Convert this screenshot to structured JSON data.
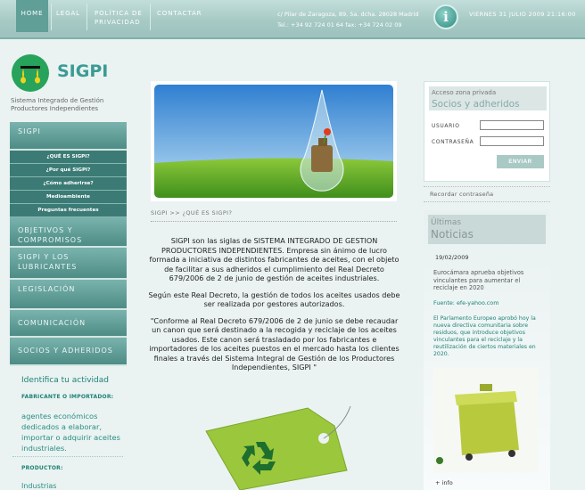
{
  "nav": {
    "home": "HOME",
    "legal": "LEGAL",
    "privacidad_l1": "POLÍTICA DE",
    "privacidad_l2": "PRIVACIDAD",
    "contactar": "CONTACTAR"
  },
  "address": {
    "line1": "c/ Pilar de Zaragoza, 89, 5a. dcha.   28028 Madrid",
    "line2": "Tel.: +34 92 724 01 64   fax: +34 724 02 09"
  },
  "datetime": "VIERNES 31 JULIO 2009    21:16:00",
  "info_icon": "i",
  "logo": {
    "name": "SIGPI",
    "sub_l1": "Sistema Integrado de Gestión",
    "sub_l2": "Productores Independientes"
  },
  "sidebar": {
    "sigpi": "SIGPI",
    "sub_items": [
      "¿QUÉ ES SIGPI?",
      "¿Por qué SIGPI?",
      "¿Cómo adherirse?",
      "Medioambiente",
      "Preguntas frecuentes"
    ],
    "objetivos_l1": "OBJETIVOS Y",
    "objetivos_l2": "COMPROMISOS",
    "lubricantes_l1": "SIGPI Y LOS",
    "lubricantes_l2": "LUBRICANTES",
    "legislacion": "LEGISLACIÓN",
    "comunicacion": "COMUNICACIÓN",
    "socios": "SOCIOS Y ADHERIDOS"
  },
  "identify": {
    "title": "Identifica tu actividad",
    "fabricante": "FABRICANTE O IMPORTADOR:",
    "agentes": "agentes económicos dedicados a elaborar, importar o adquirir aceites industriales.",
    "productor": "PRODUCTOR:",
    "industrias": "Industrias"
  },
  "breadcrumb": "SIGPI >> ¿QUÉ ES SIGPI?",
  "content": {
    "p1": "SIGPI son las siglas de SISTEMA INTEGRADO DE GESTION PRODUCTORES INDEPENDIENTES. Empresa sin ánimo de lucro formada a iniciativa de distintos fabricantes de aceites, con el objeto de facilitar a sus adheridos el cumplimiento del Real Decreto 679/2006 de 2 de junio de gestión de aceites industriales.",
    "p2": "Según este Real Decreto, la  gestión de todos los aceites usados debe ser realizada por gestores autorizados.",
    "p3": "\"Conforme al Real Decreto 679/2006  de 2 de junio se debe recaudar un canon que será destinado a la recogida y reciclaje de los aceites usados. Este canon será trasladado por los fabricantes e importadores de los aceites puestos en el mercado hasta los clientes finales a través del Sistema Integral de Gestión de los Productores Independientes, SIGPI \""
  },
  "login": {
    "title1": "Acceso zona privada",
    "title2": "Socios y adheridos",
    "usuario": "USUARIO",
    "password": "CONTRASEÑA",
    "submit": "ENVIAR",
    "recordar": "Recordar contraseña"
  },
  "news": {
    "title1": "Últimas",
    "title2": "Noticias",
    "date": "19/02/2009",
    "summary": "Eurocámara aprueba objetivos vinculantes para aumentar el reciclaje en 2020",
    "source": "Fuente: efe-yahoo.com",
    "body": "El Parlamento Europeo aprobó hoy la nueva directiva comunitaria sobre residuos, que introduce objetivos vinculantes para el reciclaje y la reutilización de ciertos materiales en 2020.",
    "more": "+ info"
  },
  "colors": {
    "accent": "#3a9b94",
    "nav_active": "#5f9f98",
    "menu": "#4e8c86"
  }
}
